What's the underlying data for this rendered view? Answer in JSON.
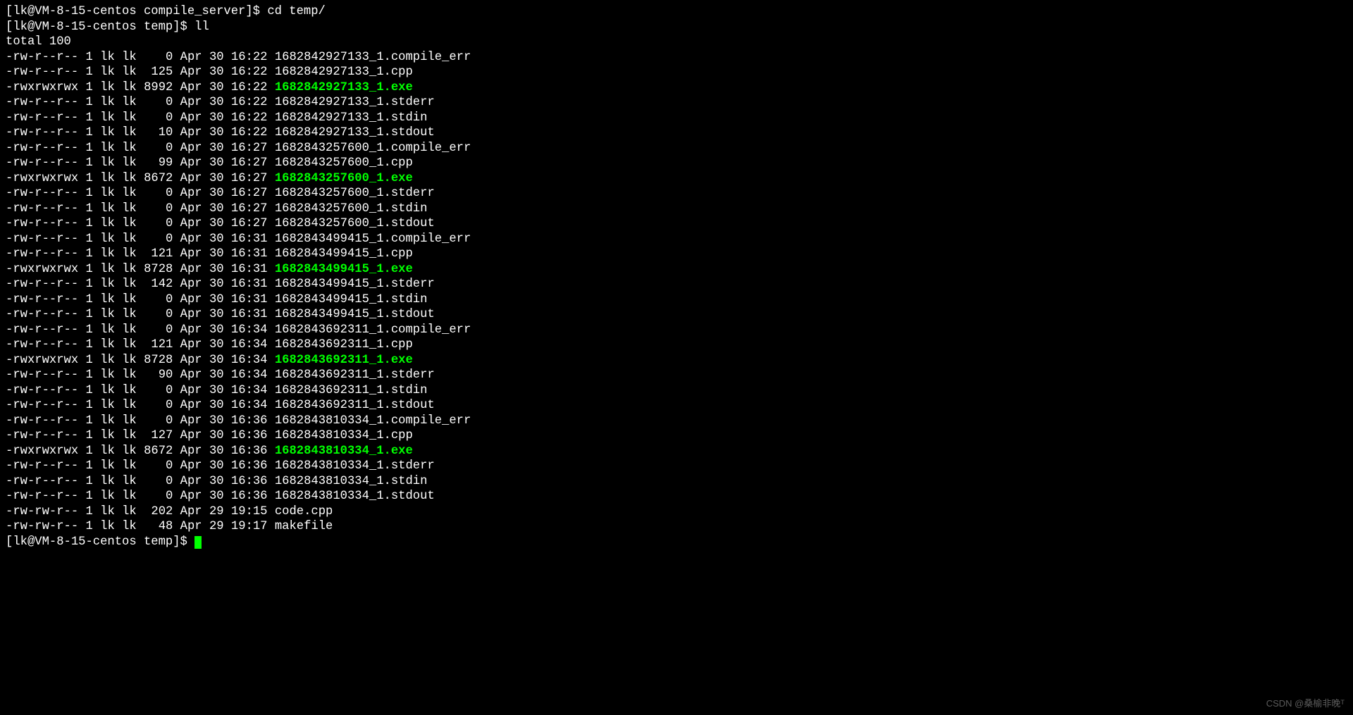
{
  "prompts": {
    "p1_prefix": "[lk@VM-8-15-centos compile_server]$ ",
    "p1_cmd": "cd temp/",
    "p2_prefix": "[lk@VM-8-15-centos temp]$ ",
    "p2_cmd": "ll",
    "p3_prefix": "[lk@VM-8-15-centos temp]$ "
  },
  "total_line": "total 100",
  "listing": [
    {
      "perm": "-rw-r--r--",
      "links": "1",
      "owner": "lk",
      "group": "lk",
      "size": "0",
      "month": "Apr",
      "day": "30",
      "time": "16:22",
      "name": "1682842927133_1.compile_err",
      "exe": false
    },
    {
      "perm": "-rw-r--r--",
      "links": "1",
      "owner": "lk",
      "group": "lk",
      "size": "125",
      "month": "Apr",
      "day": "30",
      "time": "16:22",
      "name": "1682842927133_1.cpp",
      "exe": false
    },
    {
      "perm": "-rwxrwxrwx",
      "links": "1",
      "owner": "lk",
      "group": "lk",
      "size": "8992",
      "month": "Apr",
      "day": "30",
      "time": "16:22",
      "name": "1682842927133_1.exe",
      "exe": true
    },
    {
      "perm": "-rw-r--r--",
      "links": "1",
      "owner": "lk",
      "group": "lk",
      "size": "0",
      "month": "Apr",
      "day": "30",
      "time": "16:22",
      "name": "1682842927133_1.stderr",
      "exe": false
    },
    {
      "perm": "-rw-r--r--",
      "links": "1",
      "owner": "lk",
      "group": "lk",
      "size": "0",
      "month": "Apr",
      "day": "30",
      "time": "16:22",
      "name": "1682842927133_1.stdin",
      "exe": false
    },
    {
      "perm": "-rw-r--r--",
      "links": "1",
      "owner": "lk",
      "group": "lk",
      "size": "10",
      "month": "Apr",
      "day": "30",
      "time": "16:22",
      "name": "1682842927133_1.stdout",
      "exe": false
    },
    {
      "perm": "-rw-r--r--",
      "links": "1",
      "owner": "lk",
      "group": "lk",
      "size": "0",
      "month": "Apr",
      "day": "30",
      "time": "16:27",
      "name": "1682843257600_1.compile_err",
      "exe": false
    },
    {
      "perm": "-rw-r--r--",
      "links": "1",
      "owner": "lk",
      "group": "lk",
      "size": "99",
      "month": "Apr",
      "day": "30",
      "time": "16:27",
      "name": "1682843257600_1.cpp",
      "exe": false
    },
    {
      "perm": "-rwxrwxrwx",
      "links": "1",
      "owner": "lk",
      "group": "lk",
      "size": "8672",
      "month": "Apr",
      "day": "30",
      "time": "16:27",
      "name": "1682843257600_1.exe",
      "exe": true
    },
    {
      "perm": "-rw-r--r--",
      "links": "1",
      "owner": "lk",
      "group": "lk",
      "size": "0",
      "month": "Apr",
      "day": "30",
      "time": "16:27",
      "name": "1682843257600_1.stderr",
      "exe": false
    },
    {
      "perm": "-rw-r--r--",
      "links": "1",
      "owner": "lk",
      "group": "lk",
      "size": "0",
      "month": "Apr",
      "day": "30",
      "time": "16:27",
      "name": "1682843257600_1.stdin",
      "exe": false
    },
    {
      "perm": "-rw-r--r--",
      "links": "1",
      "owner": "lk",
      "group": "lk",
      "size": "0",
      "month": "Apr",
      "day": "30",
      "time": "16:27",
      "name": "1682843257600_1.stdout",
      "exe": false
    },
    {
      "perm": "-rw-r--r--",
      "links": "1",
      "owner": "lk",
      "group": "lk",
      "size": "0",
      "month": "Apr",
      "day": "30",
      "time": "16:31",
      "name": "1682843499415_1.compile_err",
      "exe": false
    },
    {
      "perm": "-rw-r--r--",
      "links": "1",
      "owner": "lk",
      "group": "lk",
      "size": "121",
      "month": "Apr",
      "day": "30",
      "time": "16:31",
      "name": "1682843499415_1.cpp",
      "exe": false
    },
    {
      "perm": "-rwxrwxrwx",
      "links": "1",
      "owner": "lk",
      "group": "lk",
      "size": "8728",
      "month": "Apr",
      "day": "30",
      "time": "16:31",
      "name": "1682843499415_1.exe",
      "exe": true
    },
    {
      "perm": "-rw-r--r--",
      "links": "1",
      "owner": "lk",
      "group": "lk",
      "size": "142",
      "month": "Apr",
      "day": "30",
      "time": "16:31",
      "name": "1682843499415_1.stderr",
      "exe": false
    },
    {
      "perm": "-rw-r--r--",
      "links": "1",
      "owner": "lk",
      "group": "lk",
      "size": "0",
      "month": "Apr",
      "day": "30",
      "time": "16:31",
      "name": "1682843499415_1.stdin",
      "exe": false
    },
    {
      "perm": "-rw-r--r--",
      "links": "1",
      "owner": "lk",
      "group": "lk",
      "size": "0",
      "month": "Apr",
      "day": "30",
      "time": "16:31",
      "name": "1682843499415_1.stdout",
      "exe": false
    },
    {
      "perm": "-rw-r--r--",
      "links": "1",
      "owner": "lk",
      "group": "lk",
      "size": "0",
      "month": "Apr",
      "day": "30",
      "time": "16:34",
      "name": "1682843692311_1.compile_err",
      "exe": false
    },
    {
      "perm": "-rw-r--r--",
      "links": "1",
      "owner": "lk",
      "group": "lk",
      "size": "121",
      "month": "Apr",
      "day": "30",
      "time": "16:34",
      "name": "1682843692311_1.cpp",
      "exe": false
    },
    {
      "perm": "-rwxrwxrwx",
      "links": "1",
      "owner": "lk",
      "group": "lk",
      "size": "8728",
      "month": "Apr",
      "day": "30",
      "time": "16:34",
      "name": "1682843692311_1.exe",
      "exe": true
    },
    {
      "perm": "-rw-r--r--",
      "links": "1",
      "owner": "lk",
      "group": "lk",
      "size": "90",
      "month": "Apr",
      "day": "30",
      "time": "16:34",
      "name": "1682843692311_1.stderr",
      "exe": false
    },
    {
      "perm": "-rw-r--r--",
      "links": "1",
      "owner": "lk",
      "group": "lk",
      "size": "0",
      "month": "Apr",
      "day": "30",
      "time": "16:34",
      "name": "1682843692311_1.stdin",
      "exe": false
    },
    {
      "perm": "-rw-r--r--",
      "links": "1",
      "owner": "lk",
      "group": "lk",
      "size": "0",
      "month": "Apr",
      "day": "30",
      "time": "16:34",
      "name": "1682843692311_1.stdout",
      "exe": false
    },
    {
      "perm": "-rw-r--r--",
      "links": "1",
      "owner": "lk",
      "group": "lk",
      "size": "0",
      "month": "Apr",
      "day": "30",
      "time": "16:36",
      "name": "1682843810334_1.compile_err",
      "exe": false
    },
    {
      "perm": "-rw-r--r--",
      "links": "1",
      "owner": "lk",
      "group": "lk",
      "size": "127",
      "month": "Apr",
      "day": "30",
      "time": "16:36",
      "name": "1682843810334_1.cpp",
      "exe": false
    },
    {
      "perm": "-rwxrwxrwx",
      "links": "1",
      "owner": "lk",
      "group": "lk",
      "size": "8672",
      "month": "Apr",
      "day": "30",
      "time": "16:36",
      "name": "1682843810334_1.exe",
      "exe": true
    },
    {
      "perm": "-rw-r--r--",
      "links": "1",
      "owner": "lk",
      "group": "lk",
      "size": "0",
      "month": "Apr",
      "day": "30",
      "time": "16:36",
      "name": "1682843810334_1.stderr",
      "exe": false
    },
    {
      "perm": "-rw-r--r--",
      "links": "1",
      "owner": "lk",
      "group": "lk",
      "size": "0",
      "month": "Apr",
      "day": "30",
      "time": "16:36",
      "name": "1682843810334_1.stdin",
      "exe": false
    },
    {
      "perm": "-rw-r--r--",
      "links": "1",
      "owner": "lk",
      "group": "lk",
      "size": "0",
      "month": "Apr",
      "day": "30",
      "time": "16:36",
      "name": "1682843810334_1.stdout",
      "exe": false
    },
    {
      "perm": "-rw-rw-r--",
      "links": "1",
      "owner": "lk",
      "group": "lk",
      "size": "202",
      "month": "Apr",
      "day": "29",
      "time": "19:15",
      "name": "code.cpp",
      "exe": false
    },
    {
      "perm": "-rw-rw-r--",
      "links": "1",
      "owner": "lk",
      "group": "lk",
      "size": "48",
      "month": "Apr",
      "day": "29",
      "time": "19:17",
      "name": "makefile",
      "exe": false
    }
  ],
  "watermark": "CSDN @桑榆非晚ᵀ"
}
